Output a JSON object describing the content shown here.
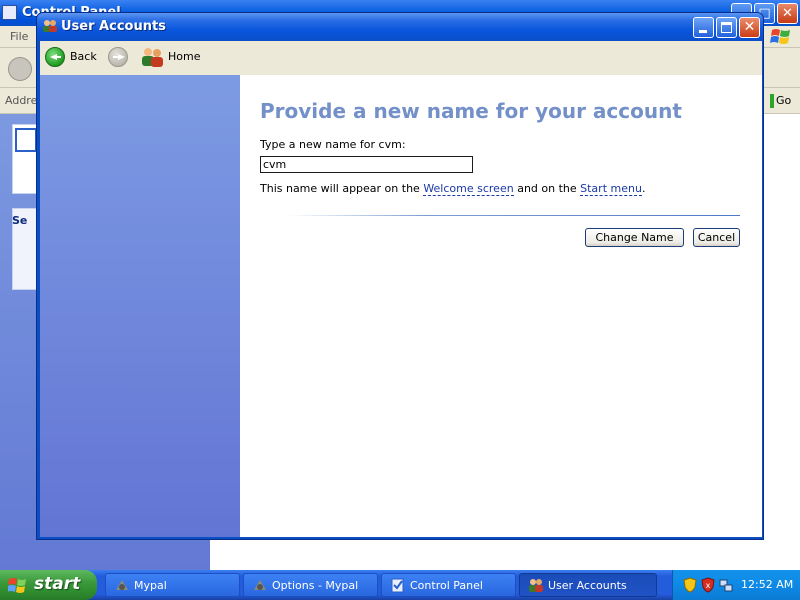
{
  "background_window": {
    "title": "Control Panel",
    "menu_file": "File",
    "address_label": "Address",
    "go_label": "Go",
    "panel2_heading": "Se"
  },
  "window": {
    "title": "User Accounts",
    "icon": "user-accounts-icon"
  },
  "nav": {
    "back_label": "Back",
    "home_label": "Home"
  },
  "content": {
    "heading": "Provide a new name for your account",
    "prompt": "Type a new name for cvm:",
    "input_value": "cvm",
    "note_prefix": "This name will appear on the ",
    "note_link1": "Welcome screen",
    "note_middle": " and on the ",
    "note_link2": "Start menu",
    "note_suffix": ".",
    "change_button": "Change Name",
    "cancel_button": "Cancel"
  },
  "taskbar": {
    "start_label": "start",
    "tasks": [
      {
        "label": "Mypal",
        "icon": "mypal-icon",
        "active": false
      },
      {
        "label": "Options - Mypal",
        "icon": "mypal-icon",
        "active": false
      },
      {
        "label": "Control Panel",
        "icon": "control-panel-icon",
        "active": false
      },
      {
        "label": "User Accounts",
        "icon": "user-accounts-icon",
        "active": true
      }
    ],
    "clock": "12:52 AM"
  },
  "colors": {
    "heading": "#7390c8",
    "link": "#1a3aa6",
    "titlebar": "#0a56de",
    "start_green": "#3c9a3c"
  }
}
